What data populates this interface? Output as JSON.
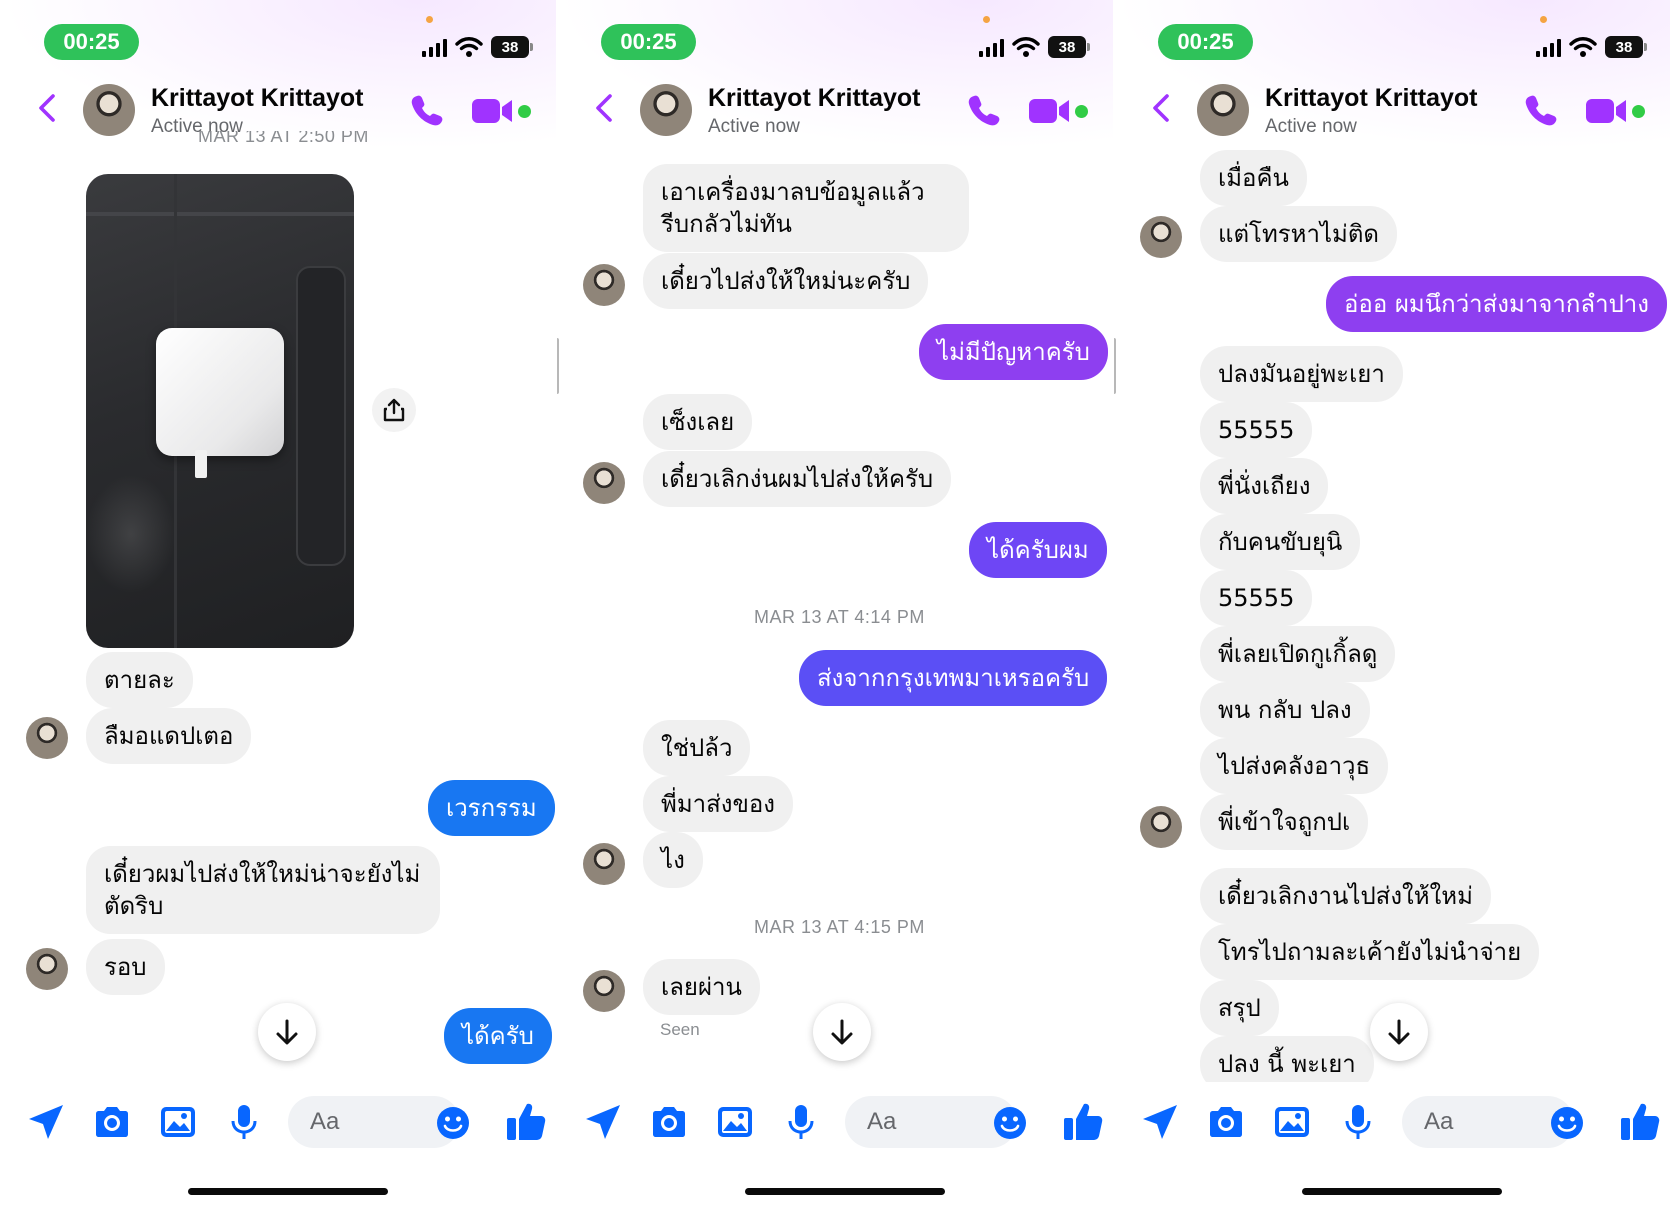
{
  "colors": {
    "outgoing_blue": "#1877f2",
    "outgoing_purple": "#8e3ff0",
    "accent": "#a033ff",
    "messenger_blue": "#0866ff",
    "status_green": "#2fc25a",
    "incoming_bg": "#f0f0f0"
  },
  "status": {
    "time": "00:25",
    "battery": "38"
  },
  "header": {
    "name": "Krittayot Krittayot",
    "subtitle": "Active now"
  },
  "composer": {
    "placeholder": "Aa"
  },
  "panels": [
    {
      "partial_stamp": "MAR 13 AT 2:50 PM",
      "messages": [
        {
          "side": "in",
          "text": "ตายละ"
        },
        {
          "side": "in",
          "text": "ลืมอแดปเตอ"
        },
        {
          "side": "out",
          "text": "เวรกรรม"
        },
        {
          "side": "in",
          "text": "เดี๋ยวผมไปส่งให้ใหม่น่าจะยังไม่ตัดริบ"
        },
        {
          "side": "in",
          "text": "รอบ"
        },
        {
          "side": "out",
          "text": "ได้ครับ"
        }
      ]
    },
    {
      "messages": [
        {
          "side": "in",
          "text": "เอาเครื่องมาลบข้อมูลแล้วรีบกลัวไม่ทัน"
        },
        {
          "side": "in",
          "text": "เดี๋ยวไปส่งให้ใหม่นะครับ"
        },
        {
          "side": "out",
          "text": "ไม่มีปัญหาครับ"
        },
        {
          "side": "in",
          "text": "เซ็งเลย"
        },
        {
          "side": "in",
          "text": "เดี๋ยวเลิกง่นผมไปส่งให้ครับ"
        },
        {
          "side": "out",
          "text": "ได้ครับผม"
        },
        {
          "side": "stamp",
          "text": "MAR 13 AT 4:14 PM"
        },
        {
          "side": "out",
          "text": "ส่งจากกรุงเทพมาเหรอครับ"
        },
        {
          "side": "in",
          "text": "ใช่ปล้ว"
        },
        {
          "side": "in",
          "text": "พี่มาส่งของ"
        },
        {
          "side": "in",
          "text": "ไง"
        },
        {
          "side": "stamp",
          "text": "MAR 13 AT 4:15 PM"
        },
        {
          "side": "in",
          "text": "เลยผ่าน"
        }
      ],
      "seen": "Seen"
    },
    {
      "messages": [
        {
          "side": "in",
          "text": "เมื่อคืน"
        },
        {
          "side": "in",
          "text": "แต่โทรหาไม่ติด"
        },
        {
          "side": "out",
          "text": "อ่ออ ผมนึกว่าส่งมาจากลำปาง"
        },
        {
          "side": "in",
          "text": "ปลงมันอยู่พะเยา"
        },
        {
          "side": "in",
          "text": "55555"
        },
        {
          "side": "in",
          "text": "พี่นั่งเถียง"
        },
        {
          "side": "in",
          "text": "กับคนขับยุนิ"
        },
        {
          "side": "in",
          "text": "55555"
        },
        {
          "side": "in",
          "text": "พี่เลยเปิดกูเกิ้ลดู"
        },
        {
          "side": "in",
          "text": "พน กลับ ปลง"
        },
        {
          "side": "in",
          "text": "ไปส่งคลังอาวุธ"
        },
        {
          "side": "in",
          "text": "พี่เข้าใจถูกปเ"
        },
        {
          "side": "in",
          "text": "เดี๋ยวเลิกงานไปส่งให้ใหม่"
        },
        {
          "side": "in",
          "text": "โทรไปถามละเค้ายังไม่นำจ่าย"
        },
        {
          "side": "in",
          "text": "สรุป"
        },
        {
          "side": "in",
          "text": "ปลง นี้ พะเยา"
        }
      ]
    }
  ]
}
